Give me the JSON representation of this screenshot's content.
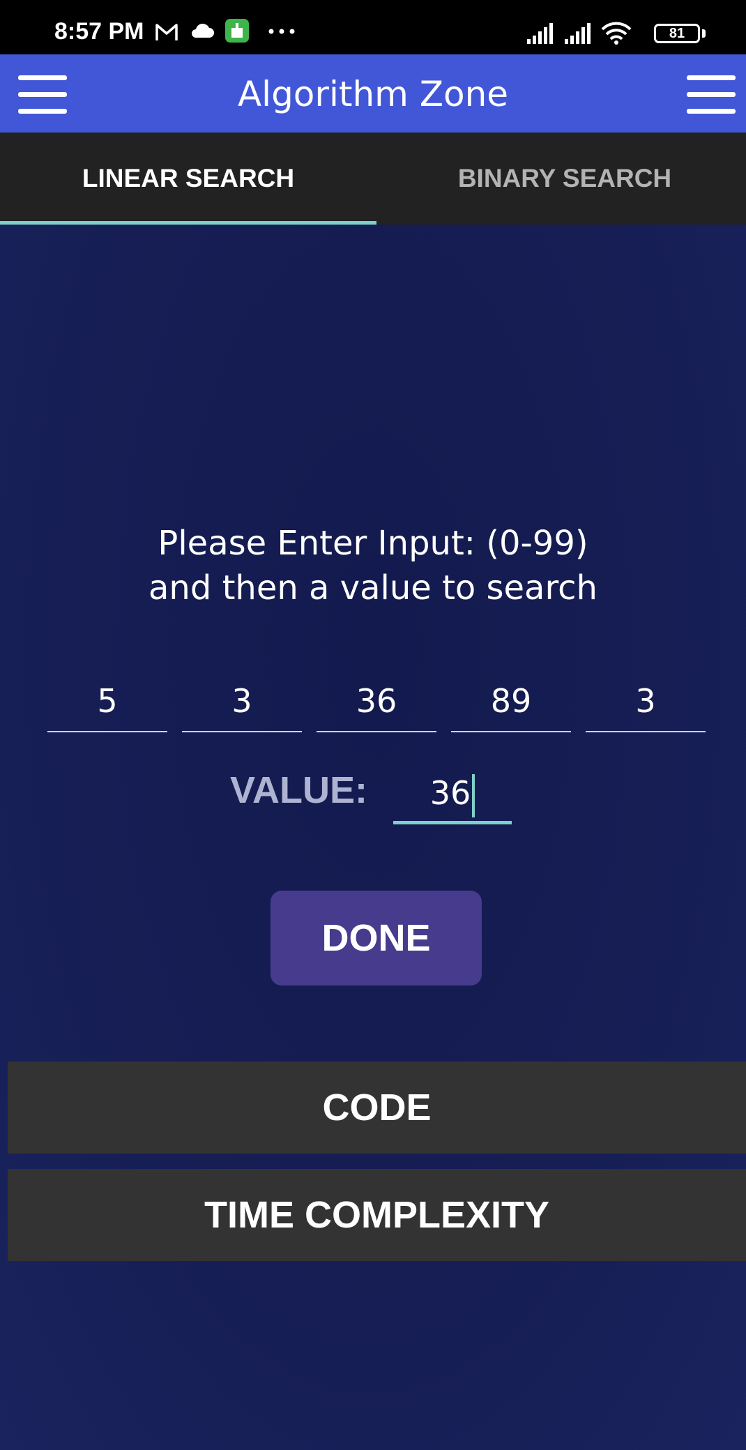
{
  "status_bar": {
    "time": "8:57 PM",
    "left_icons": [
      "gmail-icon",
      "cloud-icon",
      "app-notification-icon",
      "more-dots-icon"
    ],
    "right_icons": [
      "signal-icon",
      "signal-icon",
      "wifi-icon",
      "battery-icon"
    ],
    "battery_level": "81"
  },
  "app_bar": {
    "title": "Algorithm Zone",
    "left_icon": "menu-icon",
    "right_icon": "menu-icon"
  },
  "tabs": [
    {
      "label": "LINEAR SEARCH",
      "selected": true
    },
    {
      "label": "BINARY SEARCH",
      "selected": false
    }
  ],
  "prompt": {
    "line1": "Please Enter Input:  (0-99)",
    "line2": "and then a value to search"
  },
  "inputs": [
    "5",
    "3",
    "36",
    "89",
    "3"
  ],
  "value": {
    "label": "VALUE:",
    "current": "36"
  },
  "buttons": {
    "done": "DONE",
    "code": "CODE",
    "time_complexity": "TIME COMPLEXITY"
  },
  "colors": {
    "app_bar": "#4257d7",
    "tab_bar": "#222222",
    "tab_indicator": "#7fd0c8",
    "background": "#141b4d",
    "done_button": "#473b8e",
    "wide_button": "#333333"
  }
}
